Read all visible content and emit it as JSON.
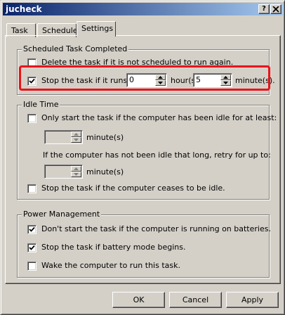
{
  "window": {
    "title": "jucheck",
    "help_button": "?",
    "close_button": "X"
  },
  "tabs": [
    {
      "label": "Task",
      "active": false
    },
    {
      "label": "Schedule",
      "active": false
    },
    {
      "label": "Settings",
      "active": true
    }
  ],
  "scheduled_task_completed": {
    "legend": "Scheduled Task Completed",
    "delete_if_not_scheduled": {
      "label": "Delete the task if it is not scheduled to run again.",
      "checked": false
    },
    "stop_if_runs_for": {
      "label": "Stop the task if it runs for:",
      "checked": true
    },
    "hours_value": "0",
    "hours_label": "hour(s)",
    "minutes_value": "5",
    "minutes_label": "minute(s)."
  },
  "idle_time": {
    "legend": "Idle Time",
    "only_start_if_idle": {
      "label": "Only start the task if the computer has been idle for at least:",
      "checked": false
    },
    "idle_minutes_value": "",
    "idle_minutes_label": "minute(s)",
    "retry_text": "If the computer has not been idle that long, retry for up to:",
    "retry_minutes_value": "",
    "retry_minutes_label": "minute(s)",
    "stop_if_ceases_idle": {
      "label": "Stop the task if the computer ceases to be idle.",
      "checked": false
    }
  },
  "power_management": {
    "legend": "Power Management",
    "dont_start_on_batteries": {
      "label": "Don't start the task if the computer is running on batteries.",
      "checked": true
    },
    "stop_if_battery_mode": {
      "label": "Stop the task if battery mode begins.",
      "checked": true
    },
    "wake_to_run": {
      "label": "Wake the computer to run this task.",
      "checked": false
    }
  },
  "buttons": {
    "ok": "OK",
    "cancel": "Cancel",
    "apply": "Apply"
  },
  "colors": {
    "title_gradient_start": "#0a246a",
    "title_gradient_end": "#a6caf0",
    "highlight": "#e8141a",
    "face": "#d4d0c8"
  }
}
